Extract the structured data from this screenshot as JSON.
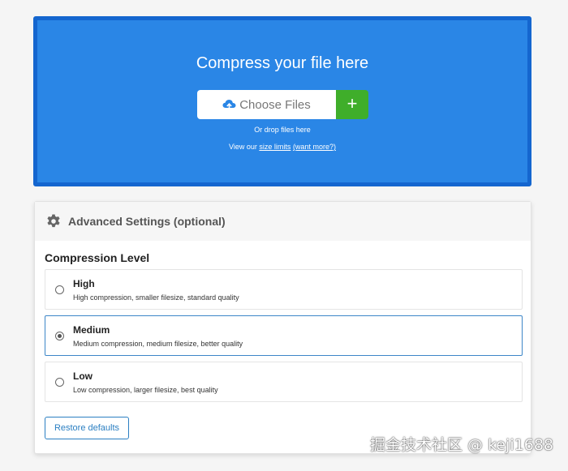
{
  "upload": {
    "title": "Compress your file here",
    "choose_label": "Choose Files",
    "add_label": "+",
    "drop_text": "Or drop files here",
    "limits_prefix": "View our ",
    "limits_link": "size limits",
    "more_link": "(want more?)"
  },
  "settings": {
    "header": "Advanced Settings (optional)",
    "section_title": "Compression Level",
    "options": [
      {
        "label": "High",
        "description": "High compression, smaller filesize, standard quality",
        "selected": false
      },
      {
        "label": "Medium",
        "description": "Medium compression, medium filesize, better quality",
        "selected": true
      },
      {
        "label": "Low",
        "description": "Low compression, larger filesize, best quality",
        "selected": false
      }
    ],
    "restore_label": "Restore defaults"
  },
  "watermark": "掘金技术社区 @ keji1688",
  "icons": {
    "upload": "cloud-upload-icon",
    "settings": "gear-icon"
  },
  "colors": {
    "panel_bg": "#2a86e6",
    "panel_border": "#1466cf",
    "add_button": "#3fae2a",
    "selected_border": "#3d86c8",
    "restore_text": "#2b7fc2"
  }
}
